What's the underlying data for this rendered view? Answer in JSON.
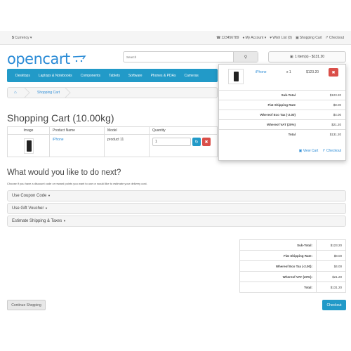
{
  "topbar": {
    "currency_symbol": "$",
    "currency_label": "Currency",
    "phone": "123456789",
    "my_account": "My Account",
    "wish_list": "Wish List (0)",
    "shopping_cart": "Shopping Cart",
    "checkout": "Checkout"
  },
  "header": {
    "logo": "opencart",
    "search_placeholder": "Search",
    "cart_button": "1 item(s) - $131.20"
  },
  "nav": {
    "items": [
      "Desktops",
      "Laptops & Notebooks",
      "Components",
      "Tablets",
      "Software",
      "Phones & PDAs",
      "Cameras"
    ]
  },
  "breadcrumb": {
    "current": "Shopping Cart"
  },
  "page_title": "Shopping Cart  (10.00kg)",
  "cart_table": {
    "headers": [
      "Image",
      "Product Name",
      "Model",
      "Quantity"
    ],
    "row": {
      "product_name": "iPhone",
      "model": "product 11",
      "quantity": "1"
    }
  },
  "dropdown_cart": {
    "item": {
      "name": "iPhone",
      "qty": "x 1",
      "price": "$123.20"
    },
    "totals": [
      {
        "label": "Sub-Total",
        "value": "$123.20"
      },
      {
        "label": "Flat Shipping Rate",
        "value": "$8.00"
      },
      {
        "label": "Whereof Eco Tax (-2.00)",
        "value": "$4.00"
      },
      {
        "label": "Whereof VAT (20%)",
        "value": "$21.20"
      },
      {
        "label": "Total",
        "value": "$131.20"
      }
    ],
    "view_cart": "View Cart",
    "checkout": "Checkout"
  },
  "next_section": {
    "title": "What would you like to do next?",
    "description": "Choose if you have a discount code or reward points you want to use or would like to estimate your delivery cost.",
    "panels": [
      "Use Coupon Code",
      "Use Gift Voucher",
      "Estimate Shipping & Taxes"
    ]
  },
  "totals": [
    {
      "label": "Sub-Total:",
      "value": "$123.20"
    },
    {
      "label": "Flat Shipping Rate:",
      "value": "$8.00"
    },
    {
      "label": "Whereof Eco Tax (-2.00):",
      "value": "$4.00"
    },
    {
      "label": "Whereof VAT (20%):",
      "value": "$21.20"
    },
    {
      "label": "Total:",
      "value": "$131.20"
    }
  ],
  "buttons": {
    "continue": "Continue Shopping",
    "checkout": "Checkout"
  },
  "colors": {
    "accent": "#229ac8",
    "danger": "#da4f49",
    "link": "#2a8bd6"
  }
}
